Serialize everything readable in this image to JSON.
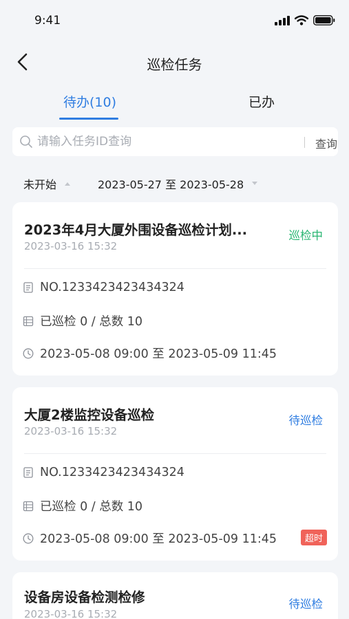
{
  "status_bar": {
    "time": "9:41"
  },
  "nav": {
    "title": "巡检任务"
  },
  "tabs": [
    {
      "label": "待办(10)",
      "active": true
    },
    {
      "label": "已办",
      "active": false
    }
  ],
  "search": {
    "placeholder": "请输入任务ID查询",
    "button_label": "查询"
  },
  "filters": {
    "status": "未开始",
    "date_range": "2023-05-27 至 2023-05-28"
  },
  "colors": {
    "accent": "#2f7de1",
    "status_in_progress": "#2bb673",
    "status_pending": "#2f7de1",
    "overtime": "#f0635a"
  },
  "tasks": [
    {
      "title": "2023年4月大厦外围设备巡检计划...",
      "created": "2023-03-16 15:32",
      "status": "巡检中",
      "number": "NO.1233423423434324",
      "progress": "已巡检 0 / 总数 10",
      "period": "2023-05-08 09:00 至 2023-05-09 11:45",
      "badge": ""
    },
    {
      "title": "大厦2楼监控设备巡检",
      "created": "2023-03-16 15:32",
      "status": "待巡检",
      "number": "NO.1233423423434324",
      "progress": "已巡检 0 / 总数 10",
      "period": "2023-05-08 09:00 至 2023-05-09 11:45",
      "badge": "超时"
    },
    {
      "title": "设备房设备检测检修",
      "created": "2023-03-16 15:32",
      "status": "待巡检"
    }
  ]
}
